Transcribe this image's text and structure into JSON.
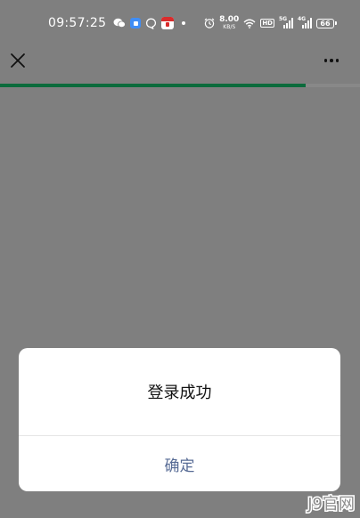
{
  "status_bar": {
    "time": "09:57:25",
    "net_speed_value": "8.00",
    "net_speed_unit": "KB/S",
    "hd_label": "HD",
    "signal1_label": "5G",
    "signal2_label": "4G",
    "battery_level": "66",
    "icons": [
      "wechat-icon",
      "blue-app-icon",
      "qq-icon",
      "red-app-icon",
      "dot-icon",
      "alarm-icon",
      "wifi-icon",
      "signal-icon",
      "battery-icon"
    ]
  },
  "nav": {
    "close_icon": "close-icon",
    "more_icon": "more-icon"
  },
  "progress": {
    "value_percent": 85,
    "color": "#0b6b3c"
  },
  "dialog": {
    "message": "登录成功",
    "confirm_label": "确定",
    "confirm_color": "#576b95"
  },
  "watermark": {
    "text": "J9官网"
  },
  "colors": {
    "overlay": "#7f7f7f",
    "dialog_bg": "#ffffff"
  }
}
